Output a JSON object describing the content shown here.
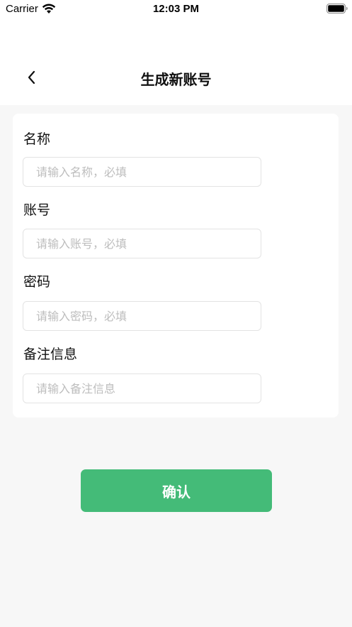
{
  "status_bar": {
    "carrier": "Carrier",
    "time": "12:03 PM",
    "wifi_icon": "wifi-icon",
    "battery_icon": "battery-icon"
  },
  "header": {
    "back_icon": "chevron-left-icon",
    "title": "生成新账号"
  },
  "form": {
    "name": {
      "label": "名称",
      "placeholder": "请输入名称，必填",
      "value": ""
    },
    "account": {
      "label": "账号",
      "placeholder": "请输入账号，必填",
      "value": ""
    },
    "password": {
      "label": "密码",
      "placeholder": "请输入密码，必填",
      "value": ""
    },
    "notes": {
      "label": "备注信息",
      "placeholder": "请输入备注信息",
      "value": ""
    }
  },
  "confirm_label": "确认",
  "colors": {
    "accent": "#44bb78",
    "background": "#f7f7f7",
    "card": "#ffffff",
    "input_border": "#e3e3e3",
    "placeholder": "#bdbdbd"
  }
}
